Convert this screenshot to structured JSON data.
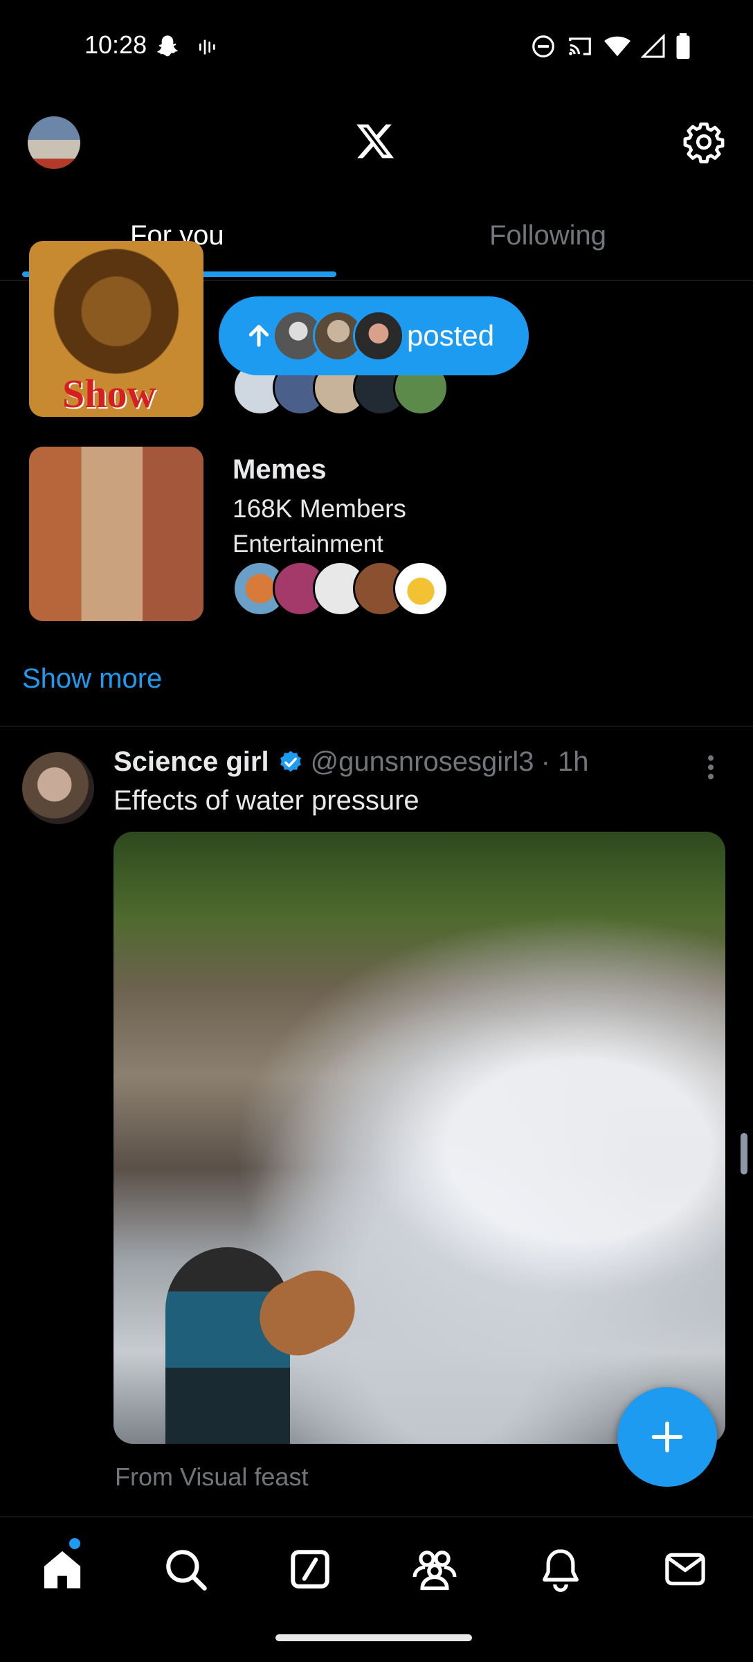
{
  "status_bar": {
    "time": "10:28",
    "icons": [
      "snapchat-icon",
      "voice-icon",
      "do-not-disturb-icon",
      "cast-icon",
      "wifi-icon",
      "signal-icon",
      "battery-icon"
    ]
  },
  "header": {
    "logo": "x-logo-icon",
    "settings_icon": "gear-icon"
  },
  "tabs": [
    {
      "label": "For you",
      "active": true
    },
    {
      "label": "Following",
      "active": false
    }
  ],
  "new_posts_pill": {
    "label": "posted"
  },
  "communities": [
    {
      "thumb_text": "Show"
    },
    {
      "name": "Memes",
      "members": "168K Members",
      "category": "Entertainment"
    }
  ],
  "show_more": "Show more",
  "tweet": {
    "author": "Science girl",
    "handle": "@gunsnrosesgirl3",
    "time": "· 1h",
    "text": "Effects of water pressure",
    "source": "From Visual feast"
  },
  "bottom_nav": [
    "home-icon",
    "search-icon",
    "grok-icon",
    "communities-icon",
    "notifications-icon",
    "messages-icon"
  ],
  "colors": {
    "accent": "#1d9bf0",
    "background": "#000000",
    "text": "#e7e9ea",
    "muted": "#71767b",
    "divider": "#2f3336"
  }
}
